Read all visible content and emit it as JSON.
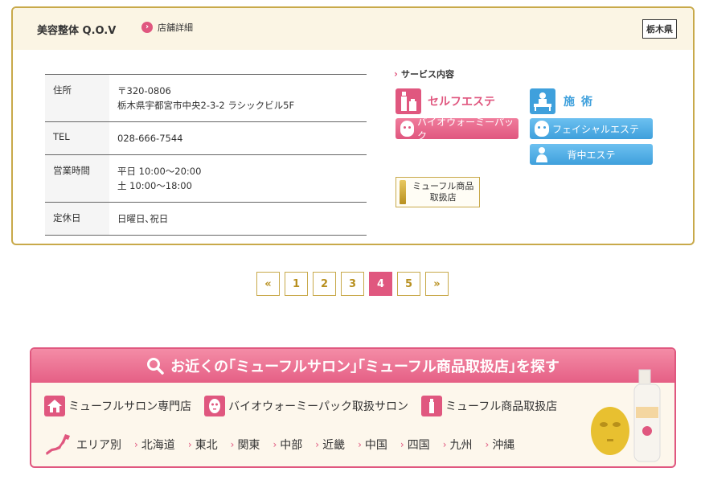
{
  "shop": {
    "name": "美容整体 Q.O.V",
    "detail_link": "店舗詳細",
    "prefecture": "栃木県",
    "rows": [
      {
        "label": "住所",
        "lines": [
          "〒320-0806",
          "栃木県宇都宮市中央2-3-2 ラシックビル5F"
        ]
      },
      {
        "label": "TEL",
        "lines": [
          "028-666-7544"
        ]
      },
      {
        "label": "営業時間",
        "lines": [
          "平日 10:00〜20:00",
          "土 10:00〜18:00"
        ]
      },
      {
        "label": "定休日",
        "lines": [
          "日曜日､祝日"
        ]
      }
    ],
    "services_title": "サービス内容",
    "self_esthe": "セルフエステ",
    "treatment": "施術",
    "bio_pack": "バイオウォーミーパック",
    "facial": "フェイシャルエステ",
    "back_esthe": "背中エステ",
    "dealer_line1": "ミューフル商品",
    "dealer_line2": "取扱店"
  },
  "pagination": {
    "prev": "«",
    "pages": [
      "1",
      "2",
      "3",
      "4",
      "5"
    ],
    "current": "4",
    "next": "»"
  },
  "search": {
    "heading": "お近くの｢ミューフルサロン｣｢ミューフル商品取扱店｣を探す",
    "links": [
      "ミューフルサロン専門店",
      "バイオウォーミーパック取扱サロン",
      "ミューフル商品取扱店"
    ],
    "area_label": "エリア別",
    "areas": [
      "北海道",
      "東北",
      "関東",
      "中部",
      "近畿",
      "中国",
      "四国",
      "九州",
      "沖縄"
    ]
  },
  "colors": {
    "accent_pink": "#e0577f",
    "accent_blue": "#3fa0dc",
    "gold": "#c8a94a"
  }
}
